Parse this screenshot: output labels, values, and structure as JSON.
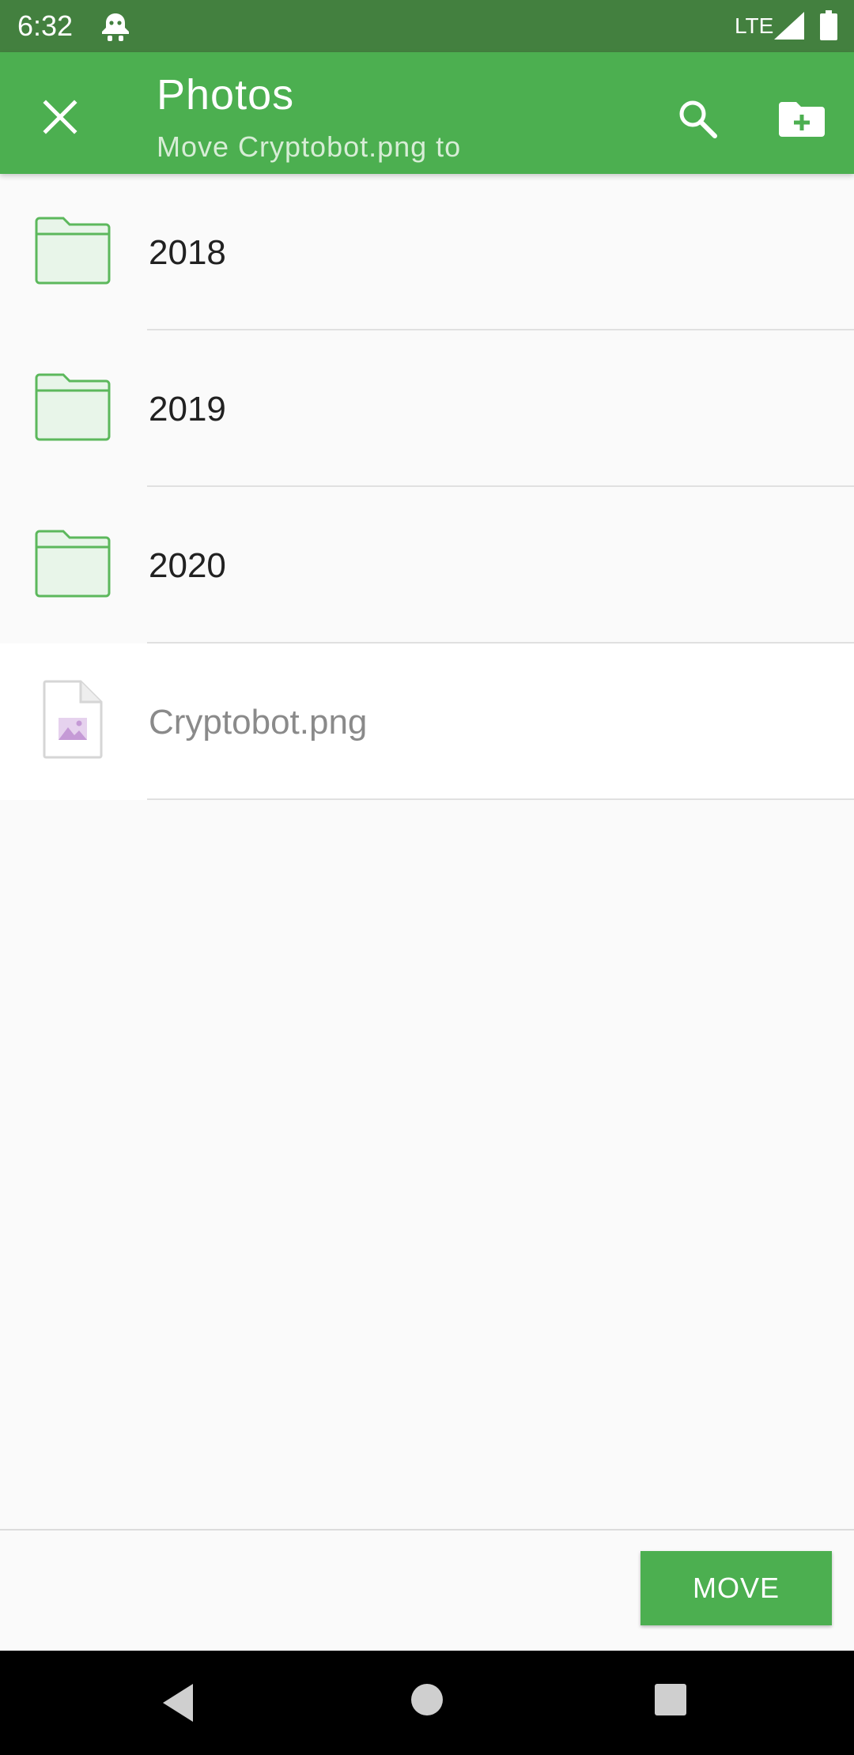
{
  "status_bar": {
    "time": "6:32",
    "network": "LTE",
    "icons": [
      "notification-bot-icon",
      "signal-icon",
      "battery-icon"
    ]
  },
  "app_bar": {
    "title": "Photos",
    "subtitle": "Move Cryptobot.png to",
    "icons": [
      "close-icon",
      "search-icon",
      "new-folder-icon"
    ]
  },
  "items": [
    {
      "label": "2018",
      "type": "folder",
      "icon": "folder-icon"
    },
    {
      "label": "2019",
      "type": "folder",
      "icon": "folder-icon"
    },
    {
      "label": "2020",
      "type": "folder",
      "icon": "folder-icon"
    },
    {
      "label": "Cryptobot.png",
      "type": "file",
      "icon": "image-file-icon"
    }
  ],
  "actions": {
    "move_label": "MOVE"
  },
  "nav_bar": {
    "icons": [
      "back-icon",
      "home-icon",
      "recents-icon"
    ]
  },
  "colors": {
    "status_bar": "#43803f",
    "app_bar": "#4caf50",
    "accent": "#4caf50",
    "folder_stroke": "#5cb85c",
    "folder_fill": "#e8f5e9"
  }
}
